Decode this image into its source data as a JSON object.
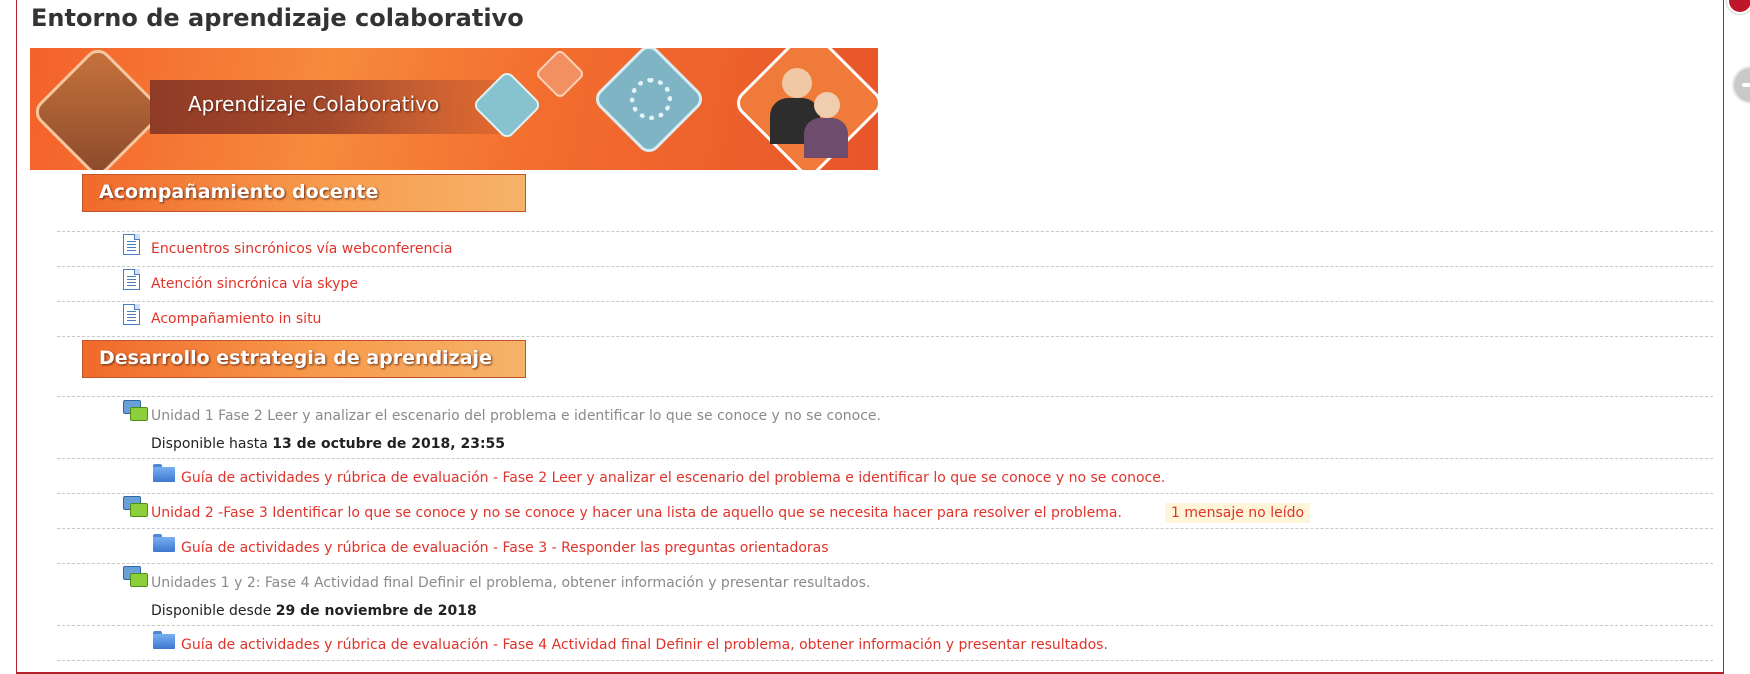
{
  "modal": {
    "title": "Entorno de aprendizaje colaborativo"
  },
  "banner": {
    "title": "Aprendizaje Colaborativo"
  },
  "sections": [
    {
      "header": "Acompañamiento docente",
      "items": [
        {
          "label": "Encuentros sincrónicos vía webconferencia",
          "icon": "page-icon"
        },
        {
          "label": "Atención sincrónica vía skype",
          "icon": "page-icon"
        },
        {
          "label": "Acompañamiento in situ",
          "icon": "page-icon"
        }
      ]
    },
    {
      "header": "Desarrollo estrategia de aprendizaje",
      "items": [
        {
          "label": "Unidad 1 Fase 2 Leer y analizar el escenario del problema e identificar lo que se conoce y no se conoce.",
          "icon": "forum-icon",
          "dimmed": true,
          "availability_prefix": "Disponible hasta",
          "availability_date": "13 de octubre de 2018, 23:55"
        },
        {
          "label": "Guía de actividades y rúbrica de evaluación - Fase 2 Leer y analizar el escenario del problema e identificar lo que se conoce y no se conoce.",
          "icon": "folder-icon"
        },
        {
          "label": "Unidad 2 -Fase 3 Identificar lo que se conoce y no se conoce y hacer una lista de aquello que se necesita hacer para resolver el problema.",
          "icon": "forum-icon",
          "badge": "1 mensaje no leído"
        },
        {
          "label": "Guía de actividades y rúbrica de evaluación - Fase 3 - Responder las preguntas orientadoras",
          "icon": "folder-icon"
        },
        {
          "label": "Unidades 1 y 2: Fase 4 Actividad final Definir el problema, obtener información y presentar resultados.",
          "icon": "forum-icon",
          "dimmed": true,
          "availability_prefix": "Disponible desde",
          "availability_date": "29 de noviembre de 2018"
        },
        {
          "label": "Guía de actividades y rúbrica de evaluación - Fase 4 Actividad final Definir el problema, obtener información y presentar resultados.",
          "icon": "folder-icon"
        }
      ]
    }
  ],
  "colors": {
    "link": "#e0332a",
    "dimmed": "#8a8a8a",
    "modal_border": "#b6202b",
    "badge_bg": "#fff6d9"
  }
}
